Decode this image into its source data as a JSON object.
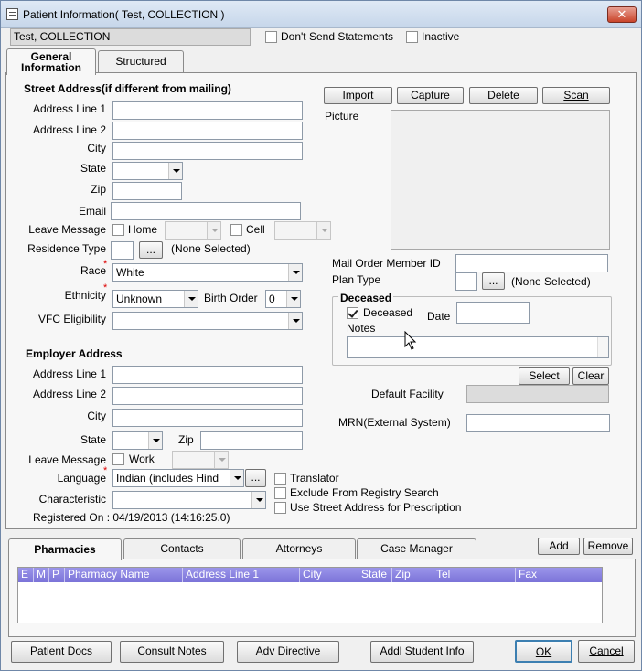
{
  "window": {
    "title": "Patient Information( Test, COLLECTION )"
  },
  "header": {
    "patient_name": "Test, COLLECTION",
    "dont_send_statements": "Don't Send Statements",
    "inactive": "Inactive"
  },
  "tabs": {
    "general_line1": "General",
    "general_line2": "Information",
    "structured": "Structured"
  },
  "street": {
    "heading": "Street Address(if different from mailing)",
    "address1": "Address Line 1",
    "address2": "Address Line 2",
    "city": "City",
    "state": "State",
    "zip": "Zip",
    "email": "Email",
    "leave_message": "Leave Message",
    "home": "Home",
    "cell": "Cell",
    "residence_type": "Residence Type",
    "residence_none": "(None Selected)",
    "race": "Race",
    "race_value": "White",
    "ethnicity": "Ethnicity",
    "ethnicity_value": "Unknown",
    "birth_order": "Birth Order",
    "birth_order_value": "0",
    "vfc": "VFC Eligibility"
  },
  "picture": {
    "import": "Import",
    "capture": "Capture",
    "delete": "Delete",
    "scan": "Scan",
    "label": "Picture"
  },
  "right": {
    "mail_order_id": "Mail Order Member ID",
    "plan_type": "Plan Type",
    "plan_none": "(None Selected)",
    "deceased_heading": "Deceased",
    "deceased": "Deceased",
    "date": "Date",
    "notes": "Notes",
    "select": "Select",
    "clear": "Clear",
    "default_facility": "Default Facility",
    "mrn": "MRN(External System)"
  },
  "employer": {
    "heading": "Employer Address",
    "address1": "Address Line 1",
    "address2": "Address Line 2",
    "city": "City",
    "state": "State",
    "zip": "Zip",
    "leave_message": "Leave Message",
    "work": "Work",
    "language": "Language",
    "language_value": "Indian (includes Hind",
    "translator": "Translator",
    "exclude_registry": "Exclude From Registry Search",
    "use_street": "Use Street Address for Prescription",
    "characteristic": "Characteristic",
    "registered_on": "Registered On : 04/19/2013 (14:16:25.0)"
  },
  "bottom_tabs": {
    "pharmacies": "Pharmacies",
    "contacts": "Contacts",
    "attorneys": "Attorneys",
    "case_manager": "Case Manager",
    "add": "Add",
    "remove": "Remove"
  },
  "grid": {
    "columns": [
      "E",
      "M",
      "P",
      "Pharmacy Name",
      "Address Line 1",
      "City",
      "State",
      "Zip",
      "Tel",
      "Fax"
    ]
  },
  "footer": {
    "patient_docs": "Patient Docs",
    "consult_notes": "Consult Notes",
    "adv_directive": "Adv Directive",
    "addl_student": "Addl Student Info",
    "ok": "OK",
    "cancel": "Cancel"
  },
  "colors": {
    "grid_header": "#8a83e0",
    "required": "#dd0000",
    "close_button": "#c9442a"
  },
  "icons": [
    "window-icon",
    "close-icon",
    "dropdown-arrow-icon",
    "mouse-cursor-icon"
  ]
}
